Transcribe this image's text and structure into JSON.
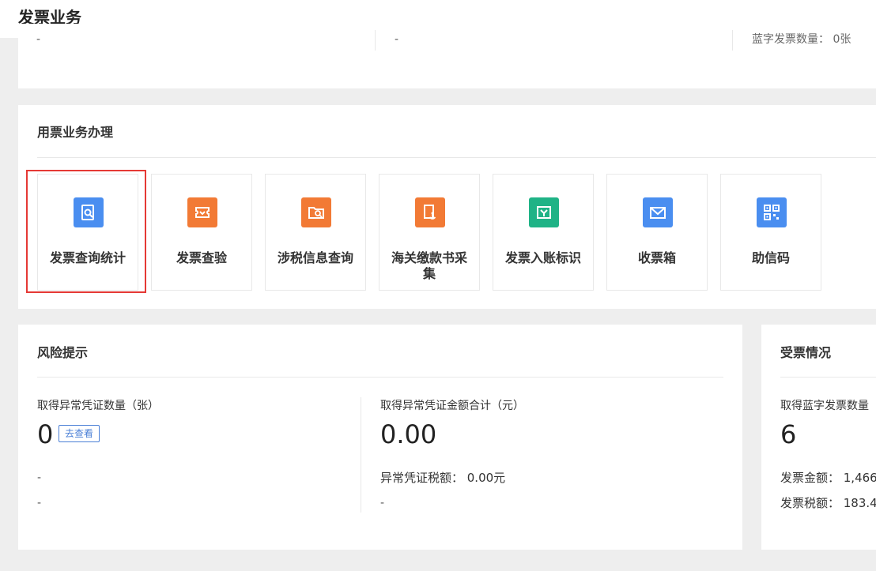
{
  "header": {
    "title": "发票业务"
  },
  "top_card": {
    "cell1": "-",
    "cell2": "-",
    "cell3": "蓝字发票数量：  0张"
  },
  "business": {
    "title": "用票业务办理",
    "tiles": [
      {
        "label": "发票查询统计",
        "icon": "invoice-search-icon",
        "color": "#4a8ef0"
      },
      {
        "label": "发票查验",
        "icon": "ticket-verify-icon",
        "color": "#f27a35"
      },
      {
        "label": "涉税信息查询",
        "icon": "folder-search-icon",
        "color": "#f27a35"
      },
      {
        "label": "海关缴款书采集",
        "icon": "anchor-document-icon",
        "color": "#f27a35"
      },
      {
        "label": "发票入账标识",
        "icon": "download-tray-icon",
        "color": "#1fb386"
      },
      {
        "label": "收票箱",
        "icon": "mail-icon",
        "color": "#4a8ef0"
      },
      {
        "label": "助信码",
        "icon": "qr-code-icon",
        "color": "#4a8ef0"
      }
    ]
  },
  "risk": {
    "title": "风险提示",
    "left_label": "取得异常凭证数量（张）",
    "left_value": "0",
    "go_button": "去查看",
    "left_dash1": "-",
    "left_dash2": "-",
    "right_label": "取得异常凭证金额合计（元）",
    "right_value": "0.00",
    "tax_label": "异常凭证税额：  0.00元",
    "right_dash": "-"
  },
  "receive": {
    "title": "受票情况",
    "label": "取得蓝字发票数量",
    "value": "6",
    "amount": "发票金额：  1,466",
    "tax": "发票税额：  183.4"
  }
}
